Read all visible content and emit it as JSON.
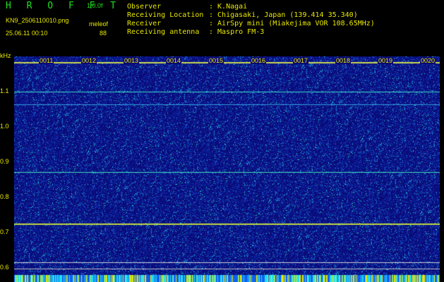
{
  "app": {
    "title": "H R O F F T",
    "version": "1.0.0f",
    "filename": "KN9_2506110010.png",
    "datetime": "25.06.11 00:10",
    "source": "meleof",
    "count": "88"
  },
  "info": {
    "rows": [
      {
        "label": "Observer",
        "value": ": K.Nagai"
      },
      {
        "label": "Receiving Location",
        "value": ": Chigasaki, Japan (139.414 35.340)"
      },
      {
        "label": "Receiver",
        "value": ": AirSpy mini (Miakejima VOR 108.65MHz)"
      },
      {
        "label": "Receiving antenna",
        "value": ": Maspro FM-3"
      }
    ]
  },
  "axis": {
    "unit": "kHz",
    "y_ticks": [
      "1.1",
      "1.0",
      "0.9",
      "0.8",
      "0.7",
      "0.6"
    ],
    "time_ticks": [
      "0011",
      "0012",
      "0013",
      "0014",
      "0015",
      "0016",
      "0017",
      "0018",
      "0019",
      "0020"
    ]
  },
  "colors": {
    "background": "#0a0a78",
    "label": "#e8e800",
    "title": "#20e020",
    "carrier": "#40e0c0"
  }
}
